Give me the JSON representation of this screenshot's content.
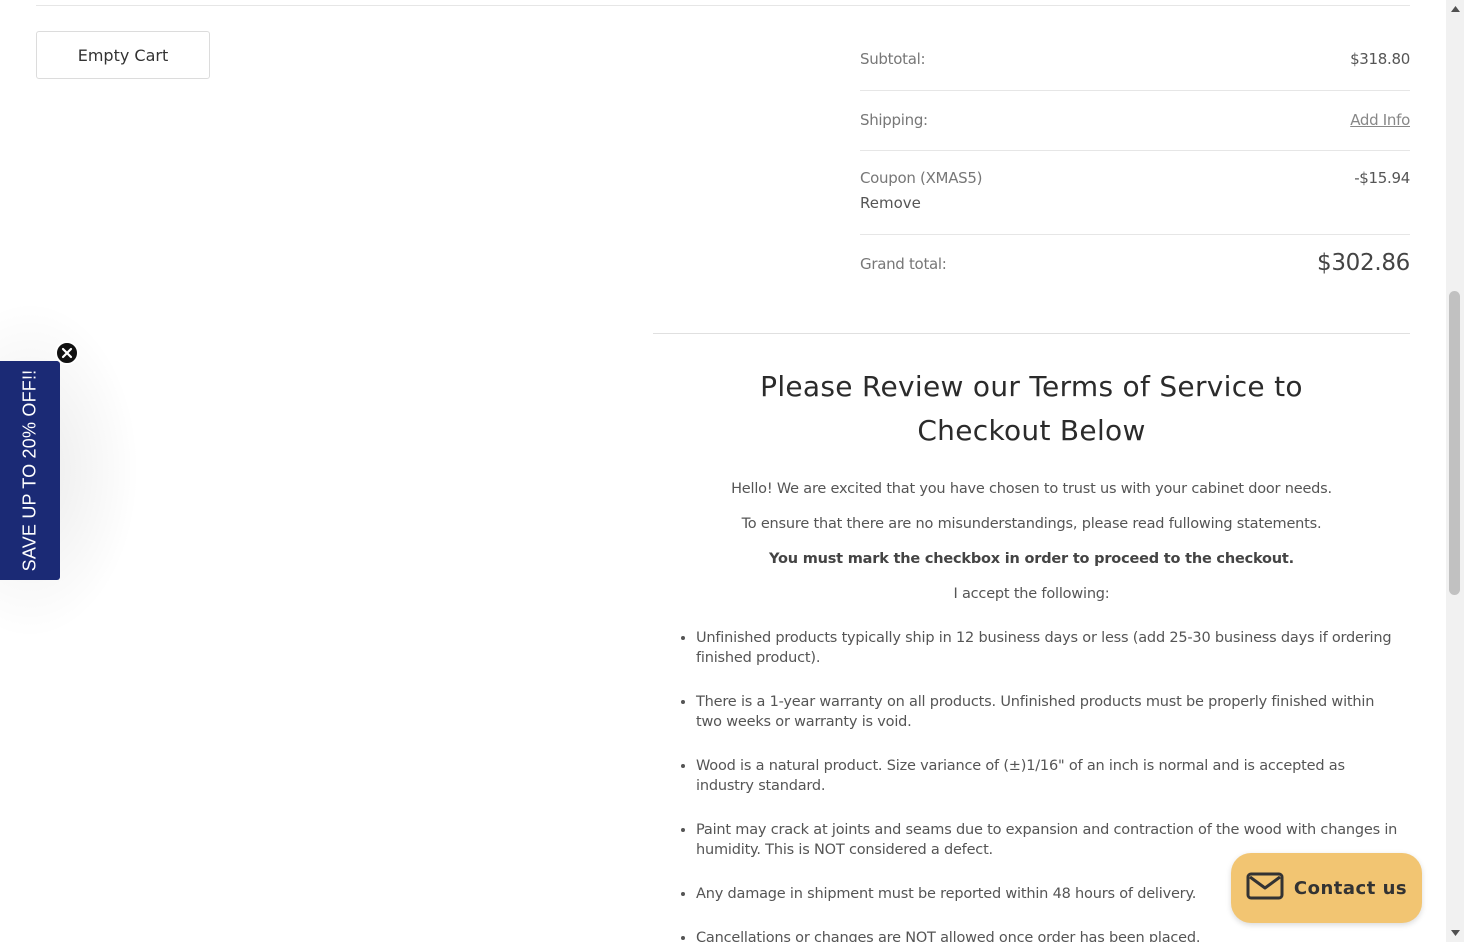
{
  "cart": {
    "empty_cart_label": "Empty Cart"
  },
  "totals": {
    "subtotal_label": "Subtotal:",
    "subtotal_value": "$318.80",
    "shipping_label": "Shipping:",
    "shipping_link": "Add Info",
    "coupon_label": "Coupon (XMAS5)",
    "coupon_remove": "Remove",
    "coupon_value": "-$15.94",
    "grand_total_label": "Grand total:",
    "grand_total_value": "$302.86"
  },
  "terms": {
    "title": "Please Review our Terms of Service to Checkout Below",
    "intro": "Hello! We are excited that you have chosen to trust us with your cabinet door needs.",
    "ensure": "To ensure that there are no misunderstandings, please read fullowing statements.",
    "must_mark": "You must mark the checkbox in order to proceed to the checkout.",
    "accept": "I accept the following:",
    "items": [
      "Unfinished products typically ship in 12 business days or less (add 25-30 business days if ordering finished product).",
      "There is a 1-year warranty on all products. Unfinished products must be properly finished within two weeks or warranty is void.",
      "Wood is a natural product. Size variance of (±)1/16\" of an inch is normal and is accepted as industry standard.",
      "Paint may crack at joints and seams due to expansion and contraction of the wood with changes in humidity. This is NOT considered a defect.",
      "Any damage in shipment must be reported within 48 hours of delivery.",
      "Cancellations or changes are NOT allowed once order has been placed."
    ]
  },
  "promo": {
    "text": "SAVE UP TO 20% OFF!!",
    "color": "#1b2a75"
  },
  "contact": {
    "label": "Contact us",
    "color": "#f2c572",
    "icon": "envelope-icon"
  }
}
